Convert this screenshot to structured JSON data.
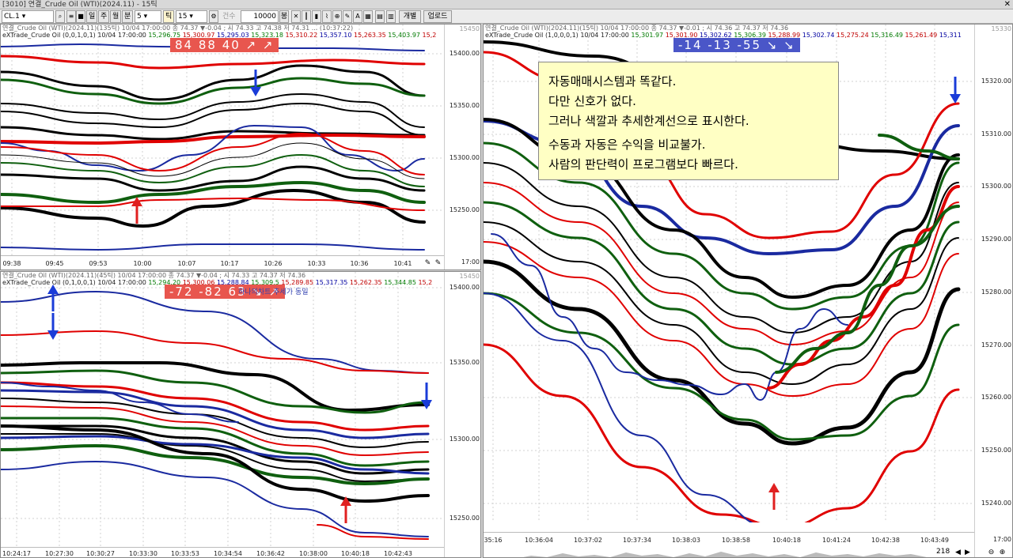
{
  "window": {
    "title": "[3010] 연결_Crude Oil (WTI)(2024.11) - 15틱",
    "close": "✕"
  },
  "toolbar": {
    "symbol": "CL.1",
    "period_buttons": [
      "일",
      "주",
      "월",
      "분"
    ],
    "minute_value": "5",
    "tick_label": "틱",
    "tick_value": "15",
    "count_label": "건수",
    "count_value": "10000",
    "count_unit": "봉",
    "split_label": "개별",
    "upload_label": "업로드"
  },
  "panels": {
    "top_left": {
      "header1": "연결_Crude Oil (WTI)(2024.11)(135틱) 10/04 17:00:00  종 74.37 ▼-0.04 ; 시 74.33 고 74.38 저 74.31 ... (10:37:22)",
      "indicator": "eXTrade_Crude Oil (0,0,1,0,1) 10/04 17:00:00",
      "values": [
        "15,296.75",
        "15,300.97",
        "15,295.03",
        "15,323.18",
        "15,310.22",
        "15,357.10",
        "15,263.35",
        "15,403.97",
        "15,2"
      ],
      "badge": "84  88  40  ↗ ↗",
      "y_ticks": [
        "15400.00",
        "15350.00",
        "15300.00",
        "15250.00"
      ],
      "x_ticks": [
        "09:38",
        "09:45",
        "09:53",
        "10:00",
        "10:07",
        "10:17",
        "10:26",
        "10:33",
        "10:36",
        "10:41"
      ],
      "corner_price": "17:00",
      "top_tick": "15450"
    },
    "bottom_left": {
      "header1": "연결_Crude Oil (WTI)(2024.11)(45틱) 10/04 17:00:00  종 74.37 ▼-0.04 ; 시 74.33 고 74.37 저 74.36",
      "indicator": "eXTrade_Crude Oil (0,1,0,0,1) 10/04 17:00:00",
      "values": [
        "15,294.20",
        "15,300.06",
        "15,288.84",
        "15,309.5",
        "15,289.85",
        "15,317.35",
        "15,262.35",
        "15,344.85",
        "15,2"
      ],
      "badge": "-72  -82  63  ↘ ↗",
      "subtitle": "하나의차트 추세가 동일",
      "y_ticks": [
        "15400.00",
        "15350.00",
        "15300.00",
        "15250.00"
      ],
      "x_ticks": [
        "10:24:17",
        "10:27:30",
        "10:30:27",
        "10:33:30",
        "10:33:53",
        "10:34:54",
        "10:36:42",
        "10:38:00",
        "10:40:18",
        "10:42:43"
      ],
      "top_tick": "15450"
    },
    "right": {
      "header1": "연결_Crude Oil (WTI)(2024.11)(15틱) 10/04 17:00:00  종 74.37 ▼-0.01 ; 시 74.36 고 74.37 저 74.36",
      "indicator": "eXTrade_Crude Oil (1,0,0,0,1) 10/04 17:00:00",
      "values": [
        "15,301.97",
        "15,301.90",
        "15,302.62",
        "15,306.39",
        "15,288.99",
        "15,302.74",
        "15,275.24",
        "15,316.49",
        "15,261.49",
        "15,311"
      ],
      "badge": "-14  -13  -55  ↘ ↘",
      "y_ticks": [
        "15320.00",
        "15310.00",
        "15300.00",
        "15290.00",
        "15280.00",
        "15270.00",
        "15260.00",
        "15250.00",
        "15240.00"
      ],
      "x_ticks": [
        "35:16",
        "10:36:04",
        "10:37:02",
        "10:37:34",
        "10:38:03",
        "10:38:58",
        "10:40:18",
        "10:41:24",
        "10:42:38",
        "10:43:49"
      ],
      "zoom": "218",
      "corner_time": "17:00",
      "top_tick": "15330"
    }
  },
  "note": {
    "lines": [
      "자동매매시스템과 똑같다.",
      "다만 신호가 없다.",
      "그러나 색깔과 추세한계선으로 표시한다."
    ],
    "lines2": [
      "수동과 자동은 수익을 비교불가.",
      "사람의 판단력이 프로그램보다 빠르다."
    ]
  },
  "colors": {
    "red": "#e00000",
    "green": "#0f5f0f",
    "blue": "#1a2aa0",
    "black": "#000000",
    "signal_red": "#e02020",
    "signal_blue": "#1a3cd8"
  }
}
